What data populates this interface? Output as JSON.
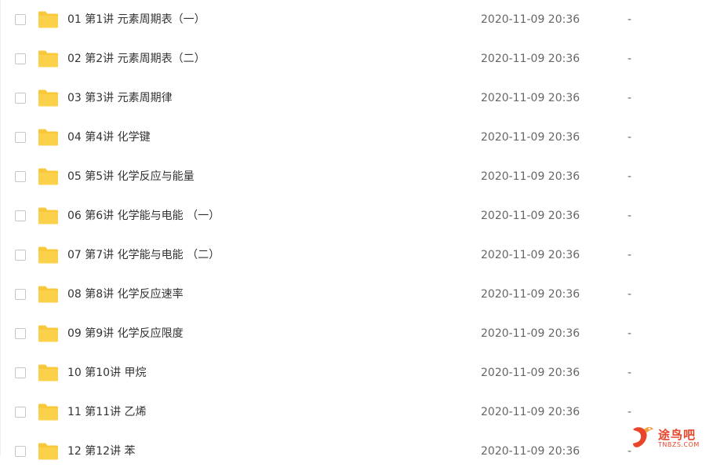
{
  "files": [
    {
      "name": "01 第1讲 元素周期表（一）",
      "modified": "2020-11-09 20:36",
      "size": "-"
    },
    {
      "name": "02 第2讲 元素周期表（二）",
      "modified": "2020-11-09 20:36",
      "size": "-"
    },
    {
      "name": "03 第3讲 元素周期律",
      "modified": "2020-11-09 20:36",
      "size": "-"
    },
    {
      "name": "04 第4讲 化学键",
      "modified": "2020-11-09 20:36",
      "size": "-"
    },
    {
      "name": "05 第5讲 化学反应与能量",
      "modified": "2020-11-09 20:36",
      "size": "-"
    },
    {
      "name": "06 第6讲 化学能与电能 （一）",
      "modified": "2020-11-09 20:36",
      "size": "-"
    },
    {
      "name": "07 第7讲 化学能与电能 （二）",
      "modified": "2020-11-09 20:36",
      "size": "-"
    },
    {
      "name": "08 第8讲 化学反应速率",
      "modified": "2020-11-09 20:36",
      "size": "-"
    },
    {
      "name": "09 第9讲 化学反应限度",
      "modified": "2020-11-09 20:36",
      "size": "-"
    },
    {
      "name": "10 第10讲 甲烷",
      "modified": "2020-11-09 20:36",
      "size": "-"
    },
    {
      "name": "11 第11讲 乙烯",
      "modified": "2020-11-09 20:36",
      "size": "-"
    },
    {
      "name": "12 第12讲 苯",
      "modified": "2020-11-09 20:36",
      "size": "-"
    }
  ],
  "folder_icon": "folder-icon",
  "folder_color": "#F9C83A",
  "watermark": {
    "text": "途鸟吧",
    "url": "TNBZS.COM"
  }
}
